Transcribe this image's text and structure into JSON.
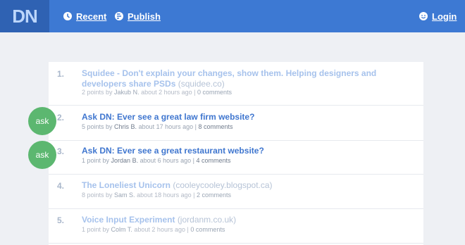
{
  "header": {
    "logo": "DN",
    "nav": {
      "recent": "Recent",
      "publish": "Publish",
      "login": "Login"
    }
  },
  "stories": [
    {
      "num": "1.",
      "title": "Squidee - Don't explain your changes, show them. Helping designers and developers share PSDs",
      "domain": "(squidee.co)",
      "points": "2 points by",
      "user": "Jakub N.",
      "time": "about 2 hours ago |",
      "comments": "0 comments"
    },
    {
      "num": "2.",
      "title": "Ask DN: Ever see a great law firm website?",
      "domain": "",
      "points": "5 points by",
      "user": "Chris B.",
      "time": "about 17 hours ago |",
      "comments": "8 comments",
      "badge": "ask"
    },
    {
      "num": "3.",
      "title": "Ask DN: Ever see a great restaurant website?",
      "domain": "",
      "points": "1 point by",
      "user": "Jordan B.",
      "time": "about 6 hours ago |",
      "comments": "4 comments",
      "badge": "ask"
    },
    {
      "num": "4.",
      "title": "The Loneliest Unicorn",
      "domain": "(cooleycooley.blogspot.ca)",
      "points": "8 points by",
      "user": "Sam S.",
      "time": "about 18 hours ago |",
      "comments": "2 comments"
    },
    {
      "num": "5.",
      "title": "Voice Input Experiment",
      "domain": "(jordanm.co.uk)",
      "points": "1 point by",
      "user": "Colm T.",
      "time": "about 2 hours ago |",
      "comments": "0 comments"
    }
  ]
}
